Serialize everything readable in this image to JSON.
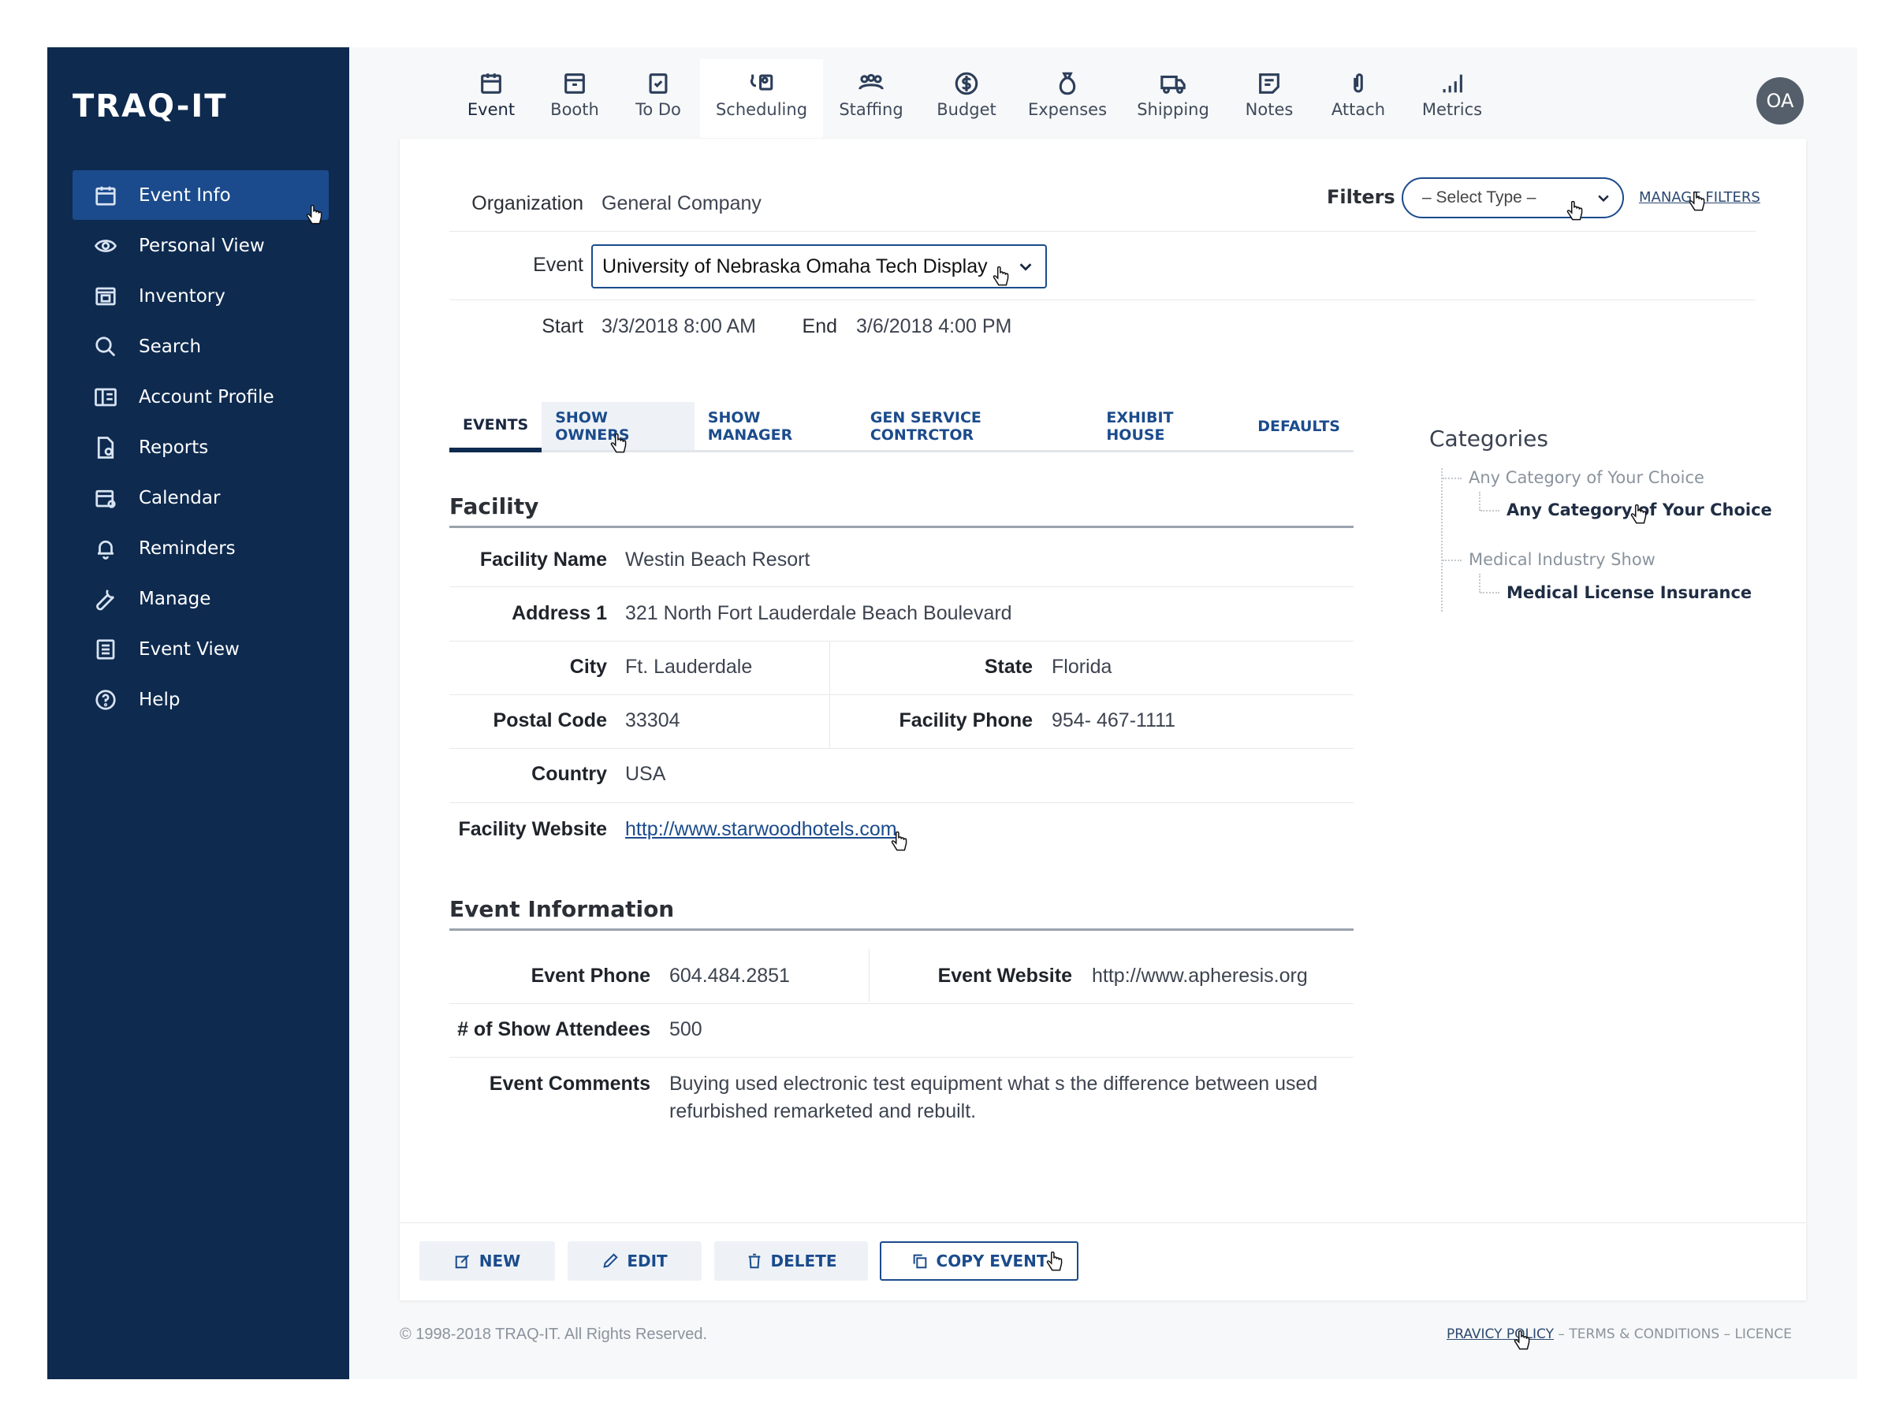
{
  "app": {
    "logo": "TRAQ-IT",
    "avatar_initials": "OA"
  },
  "sidebar": {
    "items": [
      {
        "label": "Event Info",
        "icon": "calendar-icon",
        "active": true
      },
      {
        "label": "Personal View",
        "icon": "eye-icon"
      },
      {
        "label": "Inventory",
        "icon": "inventory-icon"
      },
      {
        "label": "Search",
        "icon": "search-icon"
      },
      {
        "label": "Account Profile",
        "icon": "account-profile-icon"
      },
      {
        "label": "Reports",
        "icon": "reports-icon"
      },
      {
        "label": "Calendar",
        "icon": "calendar-settings-icon"
      },
      {
        "label": "Reminders",
        "icon": "bell-icon"
      },
      {
        "label": "Manage",
        "icon": "wrench-icon"
      },
      {
        "label": "Event View",
        "icon": "list-icon"
      },
      {
        "label": "Help",
        "icon": "help-icon"
      }
    ]
  },
  "topnav": {
    "tabs": [
      {
        "label": "Event",
        "icon": "calendar-icon"
      },
      {
        "label": "Booth",
        "icon": "booth-icon"
      },
      {
        "label": "To Do",
        "icon": "checkbox-icon"
      },
      {
        "label": "Scheduling",
        "icon": "scheduling-icon",
        "active": true
      },
      {
        "label": "Staffing",
        "icon": "people-icon"
      },
      {
        "label": "Budget",
        "icon": "dollar-icon"
      },
      {
        "label": "Expenses",
        "icon": "money-bag-icon"
      },
      {
        "label": "Shipping",
        "icon": "truck-icon"
      },
      {
        "label": "Notes",
        "icon": "notes-icon"
      },
      {
        "label": "Attach",
        "icon": "paperclip-icon"
      },
      {
        "label": "Metrics",
        "icon": "bars-icon"
      }
    ]
  },
  "header": {
    "organization_label": "Organization",
    "organization_value": "General Company",
    "event_label": "Event",
    "event_value": "University of Nebraska Omaha Tech Display",
    "start_label": "Start",
    "start_value": "3/3/2018 8:00 AM",
    "end_label": "End",
    "end_value": "3/6/2018 4:00 PM",
    "filters_label": "Filters",
    "filter_select": "– Select Type –",
    "manage_filters": "MANAGE FILTERS"
  },
  "subtabs": [
    "EVENTS",
    "SHOW OWNERS",
    "SHOW MANAGER",
    "GEN SERVICE CONTRCTOR",
    "EXHIBIT HOUSE",
    "DEFAULTS"
  ],
  "facility": {
    "title": "Facility",
    "name_label": "Facility Name",
    "name": "Westin Beach Resort",
    "address_label": "Address 1",
    "address": "321 North Fort Lauderdale Beach Boulevard",
    "city_label": "City",
    "city": "Ft. Lauderdale",
    "state_label": "State",
    "state": "Florida",
    "postal_label": "Postal Code",
    "postal": "33304",
    "phone_label": "Facility Phone",
    "phone": "954- 467-1111",
    "country_label": "Country",
    "country": "USA",
    "website_label": "Facility Website",
    "website": "http://www.starwoodhotels.com"
  },
  "event_info": {
    "title": "Event Information",
    "phone_label": "Event Phone",
    "phone": "604.484.2851",
    "website_label": "Event Website",
    "website": "http://www.apheresis.org",
    "attendees_label": "# of Show Attendees",
    "attendees": "500",
    "comments_label": "Event Comments",
    "comments_line1": "Buying used electronic test equipment what s the difference between used",
    "comments_line2": "refurbished remarketed and rebuilt."
  },
  "categories": {
    "title": "Categories",
    "items": [
      {
        "parent": "Any Category of Your Choice",
        "child": "Any Category of Your Choice"
      },
      {
        "parent": "Medical Industry Show",
        "child": "Medical License Insurance"
      }
    ]
  },
  "actions": {
    "new": "NEW",
    "edit": "EDIT",
    "delete": "DELETE",
    "copy": "COPY EVENT"
  },
  "footer": {
    "copyright": "© 1998-2018 TRAQ-IT. All Rights Reserved.",
    "privacy": "PRAVICY POLICY",
    "sep1": "–",
    "terms": "TERMS & CONDITIONS",
    "sep2": "–",
    "licence": "LICENCE"
  },
  "colors": {
    "sidebar": "#0e2a4f",
    "accent": "#1b4b8c",
    "active_item": "#1b4b8c"
  }
}
